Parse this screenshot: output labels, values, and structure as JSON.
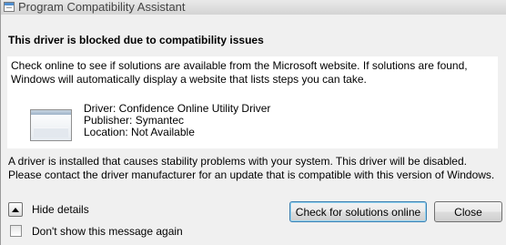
{
  "window": {
    "title": "Program Compatibility Assistant",
    "icon": "program-compatibility-icon"
  },
  "header": "This driver is blocked due to compatibility issues",
  "panel": {
    "description": "Check online to see if solutions are available from the Microsoft website. If solutions are found, Windows will automatically display a website that lists steps you can take.",
    "driver_icon": "driver-window-icon",
    "driver": "Driver: Confidence Online Utility Driver",
    "publisher": "Publisher: Symantec",
    "location": "Location: Not Available"
  },
  "info": "A driver is installed that causes stability problems with your system. This driver will be disabled. Please contact the driver manufacturer for an update that is compatible with this version of Windows.",
  "footer": {
    "hide_details_label": "Hide details",
    "dont_show_label": "Don't show this message again",
    "dont_show_checked": false,
    "check_solutions_label": "Check for solutions online",
    "close_label": "Close"
  }
}
